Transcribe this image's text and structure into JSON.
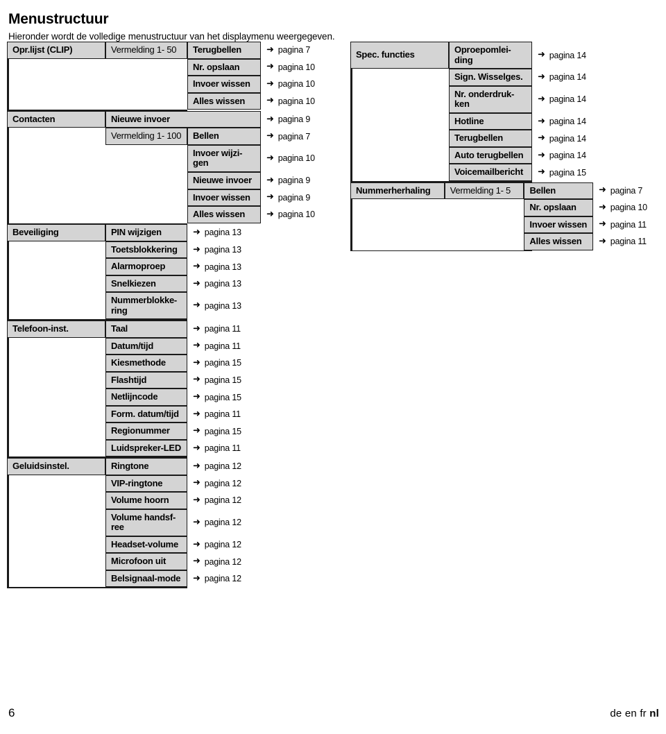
{
  "document": {
    "title": "Menustructuur",
    "subtitle": "Hieronder wordt de volledige menustructuur van het displaymenu weergegeven.",
    "arrow_glyph": "➜",
    "colors": {
      "cell_fill": "#d4d4d4",
      "border": "#1a1a1a",
      "text": "#000000",
      "page_background": "#ffffff"
    }
  },
  "left_table": {
    "groups": [
      {
        "name": "opr-lijst-clip",
        "label": "Opr.lijst (CLIP)",
        "rows": [
          {
            "col2": "Vermelding 1- 50",
            "col2_weight": "light",
            "col3": "Terugbellen",
            "ref": "pagina 7"
          },
          {
            "col2": null,
            "col3": "Nr. opslaan",
            "ref": "pagina 10"
          },
          {
            "col2": null,
            "col3": "Invoer wissen",
            "ref": "pagina 10"
          },
          {
            "col2": null,
            "col3": "Alles wissen",
            "ref": "pagina 10"
          }
        ]
      },
      {
        "name": "contacten",
        "label": "Contacten",
        "rows": [
          {
            "col23": "Nieuwe invoer",
            "ref": "pagina 9"
          },
          {
            "col2": "Vermelding 1- 100",
            "col2_weight": "light",
            "col3": "Bellen",
            "ref": "pagina 7"
          },
          {
            "col2": null,
            "col3": "Invoer wijzi-\ngen",
            "ref": "pagina 10"
          },
          {
            "col2": null,
            "col3": "Nieuwe invoer",
            "ref": "pagina 9"
          },
          {
            "col2": null,
            "col3": "Invoer wissen",
            "ref": "pagina 9"
          },
          {
            "col2": null,
            "col3": "Alles wissen",
            "ref": "pagina 10"
          }
        ]
      },
      {
        "name": "beveiliging",
        "label": "Beveiliging",
        "rows": [
          {
            "col2": "PIN wijzigen",
            "ref": "pagina 13"
          },
          {
            "col2": "Toetsblokkering",
            "ref": "pagina 13"
          },
          {
            "col2": "Alarmoproep",
            "ref": "pagina 13"
          },
          {
            "col2": "Snelkiezen",
            "ref": "pagina 13"
          },
          {
            "col2": "Nummerblokke-\nring",
            "ref": "pagina 13"
          }
        ]
      },
      {
        "name": "telefoon-inst",
        "label": "Telefoon-inst.",
        "rows": [
          {
            "col2": "Taal",
            "ref": "pagina 11"
          },
          {
            "col2": "Datum/tijd",
            "ref": "pagina 11"
          },
          {
            "col2": "Kiesmethode",
            "ref": "pagina 15"
          },
          {
            "col2": "Flashtijd",
            "ref": "pagina 15"
          },
          {
            "col2": "Netlijncode",
            "ref": "pagina 15"
          },
          {
            "col2": "Form. datum/tijd",
            "ref": "pagina 11"
          },
          {
            "col2": "Regionummer",
            "ref": "pagina 15"
          },
          {
            "col2": "Luidspreker-LED",
            "ref": "pagina 11"
          }
        ]
      },
      {
        "name": "geluidsinstel",
        "label": "Geluidsinstel.",
        "rows": [
          {
            "col2": "Ringtone",
            "ref": "pagina 12"
          },
          {
            "col2": "VIP-ringtone",
            "ref": "pagina 12"
          },
          {
            "col2": "Volume hoorn",
            "ref": "pagina 12"
          },
          {
            "col2": "Volume handsf-\nree",
            "ref": "pagina 12"
          },
          {
            "col2": "Headset-volume",
            "ref": "pagina 12"
          },
          {
            "col2": "Microfoon uit",
            "ref": "pagina 12"
          },
          {
            "col2": "Belsignaal-mode",
            "ref": "pagina 12"
          }
        ]
      }
    ]
  },
  "right_table": {
    "groups": [
      {
        "name": "spec-functies",
        "label": "Spec. functies",
        "rows": [
          {
            "col2": "Oproepomlei-\nding",
            "ref": "pagina 14"
          },
          {
            "col2": "Sign. Wisselges.",
            "ref": "pagina 14"
          },
          {
            "col2": "Nr. onderdruk-\nken",
            "ref": "pagina 14"
          },
          {
            "col2": "Hotline",
            "ref": "pagina 14"
          },
          {
            "col2": "Terugbellen",
            "ref": "pagina 14"
          },
          {
            "col2": "Auto terugbellen",
            "ref": "pagina 14"
          },
          {
            "col2": "Voicemailbericht",
            "ref": "pagina 15"
          }
        ]
      },
      {
        "name": "nummerherhaling",
        "label": "Nummerherhaling",
        "rows": [
          {
            "col2": "Vermelding 1- 5",
            "col2_weight": "light",
            "col3": "Bellen",
            "ref": "pagina 7"
          },
          {
            "col2": null,
            "col3": "Nr. opslaan",
            "ref": "pagina 10"
          },
          {
            "col2": null,
            "col3": "Invoer wissen",
            "ref": "pagina 11"
          },
          {
            "col2": null,
            "col3": "Alles wissen",
            "ref": "pagina 11"
          }
        ]
      }
    ]
  },
  "footer": {
    "page_number": "6",
    "languages": [
      "de",
      "en",
      "fr",
      "nl"
    ],
    "active_language": "nl"
  }
}
